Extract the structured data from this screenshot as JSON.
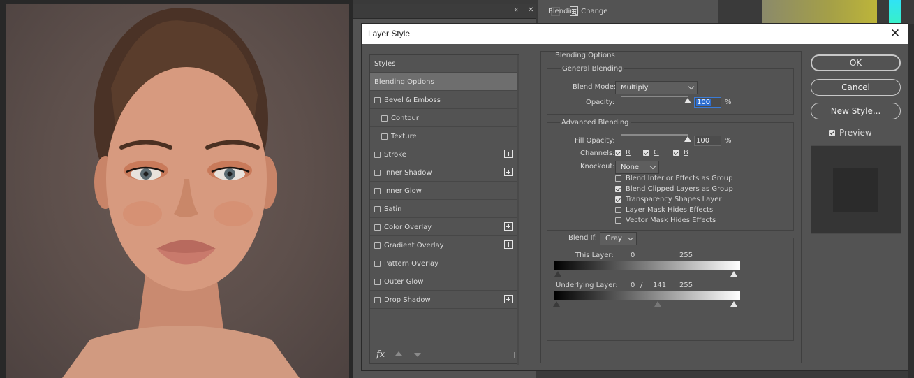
{
  "background": {
    "layers_row_label": "Blending Change",
    "panel_collapse_icon": "«",
    "panel_close_icon": "✕"
  },
  "dialog": {
    "title": "Layer Style",
    "close": "✕"
  },
  "styles": {
    "header": "Styles",
    "items": [
      {
        "label": "Blending Options",
        "has_checkbox": false,
        "selected": true,
        "indent": false,
        "has_plus": false
      },
      {
        "label": "Bevel & Emboss",
        "has_checkbox": true,
        "selected": false,
        "indent": false,
        "has_plus": false
      },
      {
        "label": "Contour",
        "has_checkbox": true,
        "selected": false,
        "indent": true,
        "has_plus": false
      },
      {
        "label": "Texture",
        "has_checkbox": true,
        "selected": false,
        "indent": true,
        "has_plus": false
      },
      {
        "label": "Stroke",
        "has_checkbox": true,
        "selected": false,
        "indent": false,
        "has_plus": true
      },
      {
        "label": "Inner Shadow",
        "has_checkbox": true,
        "selected": false,
        "indent": false,
        "has_plus": true
      },
      {
        "label": "Inner Glow",
        "has_checkbox": true,
        "selected": false,
        "indent": false,
        "has_plus": false
      },
      {
        "label": "Satin",
        "has_checkbox": true,
        "selected": false,
        "indent": false,
        "has_plus": false
      },
      {
        "label": "Color Overlay",
        "has_checkbox": true,
        "selected": false,
        "indent": false,
        "has_plus": true
      },
      {
        "label": "Gradient Overlay",
        "has_checkbox": true,
        "selected": false,
        "indent": false,
        "has_plus": true
      },
      {
        "label": "Pattern Overlay",
        "has_checkbox": true,
        "selected": false,
        "indent": false,
        "has_plus": false
      },
      {
        "label": "Outer Glow",
        "has_checkbox": true,
        "selected": false,
        "indent": false,
        "has_plus": false
      },
      {
        "label": "Drop Shadow",
        "has_checkbox": true,
        "selected": false,
        "indent": false,
        "has_plus": true
      }
    ],
    "fx_label": "fx"
  },
  "blending": {
    "section_title": "Blending Options",
    "general": {
      "title": "General Blending",
      "blend_mode_label": "Blend Mode:",
      "blend_mode_value": "Multiply",
      "opacity_label": "Opacity:",
      "opacity_value": "100",
      "opacity_unit": "%",
      "opacity_level": 1.0
    },
    "advanced": {
      "title": "Advanced Blending",
      "fill_opacity_label": "Fill Opacity:",
      "fill_opacity_value": "100",
      "fill_opacity_unit": "%",
      "fill_opacity_level": 1.0,
      "channels_label": "Channels:",
      "channels": [
        {
          "label": "R",
          "checked": true
        },
        {
          "label": "G",
          "checked": true
        },
        {
          "label": "B",
          "checked": true
        }
      ],
      "knockout_label": "Knockout:",
      "knockout_value": "None",
      "options": [
        {
          "label": "Blend Interior Effects as Group",
          "checked": false
        },
        {
          "label": "Blend Clipped Layers as Group",
          "checked": true
        },
        {
          "label": "Transparency Shapes Layer",
          "checked": true
        },
        {
          "label": "Layer Mask Hides Effects",
          "checked": false
        },
        {
          "label": "Vector Mask Hides Effects",
          "checked": false
        }
      ]
    },
    "blend_if": {
      "label": "Blend If:",
      "value": "Gray",
      "this_layer_label": "This Layer:",
      "this_layer_low": "0",
      "this_layer_high": "255",
      "underlying_label": "Underlying Layer:",
      "underlying_low": "0",
      "underlying_sep": "/",
      "underlying_split": "141",
      "underlying_high": "255"
    }
  },
  "buttons": {
    "ok": "OK",
    "cancel": "Cancel",
    "new_style": "New Style...",
    "preview_label": "Preview",
    "preview_checked": true
  }
}
